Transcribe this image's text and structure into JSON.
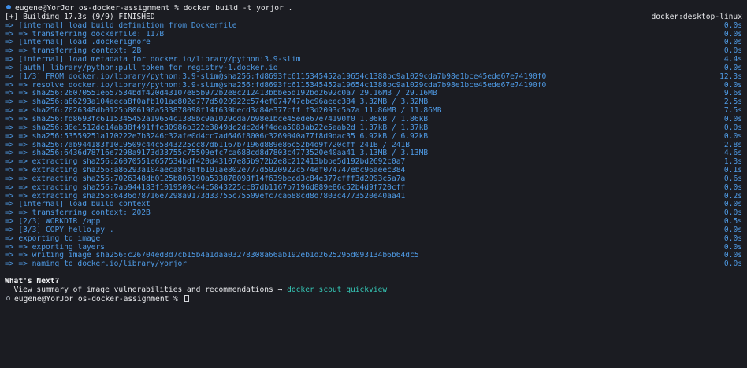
{
  "command_line": {
    "prompt": "eugene@YorJor os-docker-assignment % ",
    "command": "docker build -t yorjor ."
  },
  "build_header": {
    "text": "[+] Building 17.3s (9/9) FINISHED",
    "context": "docker:desktop-linux"
  },
  "steps": [
    {
      "text": "=> [internal] load build definition from Dockerfile",
      "time": "0.0s"
    },
    {
      "text": "=> => transferring dockerfile: 117B",
      "time": "0.0s"
    },
    {
      "text": "=> [internal] load .dockerignore",
      "time": "0.0s"
    },
    {
      "text": "=> => transferring context: 2B",
      "time": "0.0s"
    },
    {
      "text": "=> [internal] load metadata for docker.io/library/python:3.9-slim",
      "time": "4.4s"
    },
    {
      "text": "=> [auth] library/python:pull token for registry-1.docker.io",
      "time": "0.0s"
    },
    {
      "text": "=> [1/3] FROM docker.io/library/python:3.9-slim@sha256:fd8693fc6115345452a19654c1388bc9a1029cda7b98e1bce45ede67e74190f0",
      "time": "12.3s"
    },
    {
      "text": "=> => resolve docker.io/library/python:3.9-slim@sha256:fd8693fc6115345452a19654c1388bc9a1029cda7b98e1bce45ede67e74190f0",
      "time": "0.0s"
    },
    {
      "text": "=> => sha256:26070551e657534bdf420d43107e85b972b2e8c212413bbbe5d192bd2692c0a7 29.16MB / 29.16MB",
      "time": "9.6s"
    },
    {
      "text": "=> => sha256:a86293a104aeca8f0afb101ae802e777d5020922c574ef074747ebc96aeec384 3.32MB / 3.32MB",
      "time": "2.5s"
    },
    {
      "text": "=> => sha256:7026348db0125b806190a533878098f14f639becd3c84e377cff f3d2093c5a7a 11.86MB / 11.86MB",
      "time": "7.5s"
    },
    {
      "text": "=> => sha256:fd8693fc6115345452a19654c1388bc9a1029cda7b98e1bce45ede67e74190f0 1.86kB / 1.86kB",
      "time": "0.0s"
    },
    {
      "text": "=> => sha256:38e1512de14ab38f491ffe30986b322e3849dc2dc2d4f4dea5083ab22e5aab2d 1.37kB / 1.37kB",
      "time": "0.0s"
    },
    {
      "text": "=> => sha256:53559251a170222e7b3246c32afe0d4cc7ad646f8006c3269040a77f8d9dac35 6.92kB / 6.92kB",
      "time": "0.0s"
    },
    {
      "text": "=> => sha256:7ab944183f1019509c44c5843225cc87db1167b7196d889e86c52b4d9f720cff 241B / 241B",
      "time": "2.8s"
    },
    {
      "text": "=> => sha256:6436d78716e7298a9173d33755c75509efc7ca688cd8d7803c4773520e40aa41 3.13MB / 3.13MB",
      "time": "4.6s"
    },
    {
      "text": "=> => extracting sha256:26070551e657534bdf420d43107e85b972b2e8c212413bbbe5d192bd2692c0a7",
      "time": "1.3s"
    },
    {
      "text": "=> => extracting sha256:a86293a104aeca8f0afb101ae802e777d5020922c574ef074747ebc96aeec384",
      "time": "0.1s"
    },
    {
      "text": "=> => extracting sha256:7026348db0125b806190a533878098f14f639becd3c84e377cfff3d2093c5a7a",
      "time": "0.6s"
    },
    {
      "text": "=> => extracting sha256:7ab944183f1019509c44c5843225cc87db1167b7196d889e86c52b4d9f720cff",
      "time": "0.0s"
    },
    {
      "text": "=> => extracting sha256:6436d78716e7298a9173d33755c75509efc7ca688cd8d7803c4773520e40aa41",
      "time": "0.2s"
    },
    {
      "text": "=> [internal] load build context",
      "time": "0.0s"
    },
    {
      "text": "=> => transferring context: 202B",
      "time": "0.0s"
    },
    {
      "text": "=> [2/3] WORKDIR /app",
      "time": "0.5s"
    },
    {
      "text": "=> [3/3] COPY hello.py .",
      "time": "0.0s"
    },
    {
      "text": "=> exporting to image",
      "time": "0.0s"
    },
    {
      "text": "=> => exporting layers",
      "time": "0.0s"
    },
    {
      "text": "=> => writing image sha256:c26704ed8d7cb15b4a1daa03278308a66ab192eb1d2625295d093134b6b64dc5",
      "time": "0.0s"
    },
    {
      "text": "=> => naming to docker.io/library/yorjor",
      "time": "0.0s"
    }
  ],
  "whats_next": {
    "heading": "What's Next?",
    "summary_text": "  View summary of image vulnerabilities and recommendations → ",
    "summary_cmd": "docker scout quickview"
  },
  "final_prompt": {
    "text": "eugene@YorJor os-docker-assignment % "
  },
  "colors": {
    "background": "#1b1c22",
    "step_blue": "#4f9be6",
    "cmd_cyan": "#35c7b6",
    "prompt_dot_active": "#3f8ee8"
  }
}
